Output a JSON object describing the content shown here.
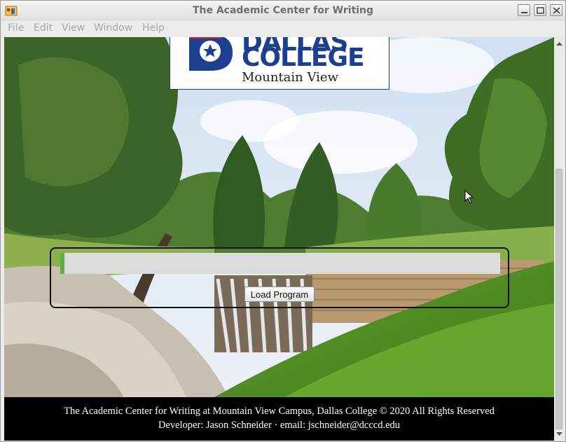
{
  "window": {
    "title": "The Academic Center for Writing",
    "app_icon": "java-app-icon",
    "controls": {
      "minimize": "minimize-icon",
      "maximize": "maximize-icon",
      "close": "close-icon"
    }
  },
  "menubar": {
    "items": [
      {
        "label": "File"
      },
      {
        "label": "Edit"
      },
      {
        "label": "View"
      },
      {
        "label": "Window"
      },
      {
        "label": "Help"
      }
    ]
  },
  "logo": {
    "line1": "DALLAS",
    "line2": "COLLEGE",
    "line3": "Mountain View",
    "brand_color": "#1d3f8f",
    "accent_color": "#d0272e"
  },
  "loader": {
    "progress_fraction": 0.01,
    "progress_color": "#5bb04a",
    "button_label": "Load Program"
  },
  "footer": {
    "line1": "The Academic Center for Writing at Mountain View Campus, Dallas College © 2020 All Rights Reserved",
    "line2": "Developer: Jason Schneider · email: jschneider@dcccd.edu"
  }
}
